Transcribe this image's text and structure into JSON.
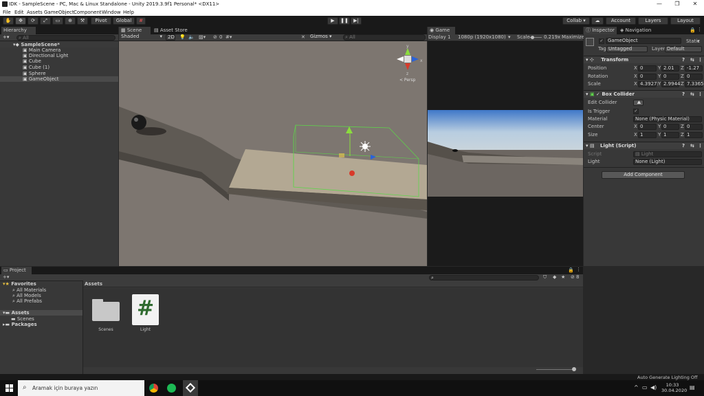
{
  "window": {
    "title": "IDK - SampleScene - PC, Mac & Linux Standalone - Unity 2019.3.9f1 Personal* <DX11>",
    "minimize": "—",
    "maximize": "❐",
    "close": "✕"
  },
  "menu": [
    "File",
    "Edit",
    "Assets",
    "GameObject",
    "Component",
    "Window",
    "Help"
  ],
  "toolbar": {
    "pivot": "Pivot",
    "global": "Global",
    "collab": "Collab ▾",
    "account": "Account",
    "layers": "Layers",
    "layout": "Layout"
  },
  "hierarchy": {
    "tab": "Hierarchy",
    "search_placeholder": "All",
    "scene": "SampleScene*",
    "items": [
      "Main Camera",
      "Directional Light",
      "Cube",
      "Cube (1)",
      "Sphere",
      "GameObject"
    ]
  },
  "scene": {
    "tabs": [
      "Scene",
      "Asset Store"
    ],
    "shading": "Shaded",
    "mode2d": "2D",
    "fx_count": "0",
    "gizmos": "Gizmos",
    "search_placeholder": "All",
    "persp": "< Persp",
    "axis_x": "x",
    "axis_y": "y",
    "axis_z": "z"
  },
  "game": {
    "tab": "Game",
    "display": "Display 1",
    "resolution": "1080p (1920x1080)",
    "scale_label": "Scale",
    "scale_value": "0.219x",
    "maximize": "Maximize"
  },
  "inspector": {
    "tabs": [
      "Inspector",
      "Navigation"
    ],
    "object_name": "GameObject",
    "static": "Static",
    "tag_label": "Tag",
    "tag_value": "Untagged",
    "layer_label": "Layer",
    "layer_value": "Default",
    "transform": {
      "title": "Transform",
      "position": {
        "label": "Position",
        "x": "0",
        "y": "2.01",
        "z": "-1.27"
      },
      "rotation": {
        "label": "Rotation",
        "x": "0",
        "y": "0",
        "z": "0"
      },
      "scale": {
        "label": "Scale",
        "x": "4.3927:",
        "y": "2.9944",
        "z": "7.3365"
      }
    },
    "box_collider": {
      "title": "Box Collider",
      "edit_collider": "Edit Collider",
      "is_trigger": "Is Trigger",
      "material_label": "Material",
      "material_value": "None (Physic Material)",
      "center": {
        "label": "Center",
        "x": "0",
        "y": "0",
        "z": "0"
      },
      "size": {
        "label": "Size",
        "x": "1",
        "y": "1",
        "z": "1"
      }
    },
    "light_script": {
      "title": "Light (Script)",
      "script_label": "Script",
      "script_value": "Light",
      "light_label": "Light",
      "light_value": "None (Light)"
    },
    "add_component": "Add Component",
    "axis": {
      "x": "X",
      "y": "Y",
      "z": "Z"
    }
  },
  "project": {
    "tab": "Project",
    "favorites": "Favorites",
    "fav_items": [
      "All Materials",
      "All Models",
      "All Prefabs"
    ],
    "assets": "Assets",
    "assets_items": [
      "Scenes"
    ],
    "packages": "Packages",
    "breadcrumb": "Assets",
    "eye_count": "8",
    "files": [
      {
        "name": "Scenes",
        "type": "folder"
      },
      {
        "name": "Light",
        "type": "script"
      }
    ],
    "script_glyph": "#"
  },
  "status": {
    "text": "Auto Generate Lighting Off"
  },
  "taskbar": {
    "search_placeholder": "Aramak için buraya yazın",
    "time": "10:33",
    "date": "30.04.2020"
  },
  "colors": {
    "selected": "#2c5d87",
    "accent_green": "#5ed44a",
    "script_green": "#2f6b2f"
  }
}
